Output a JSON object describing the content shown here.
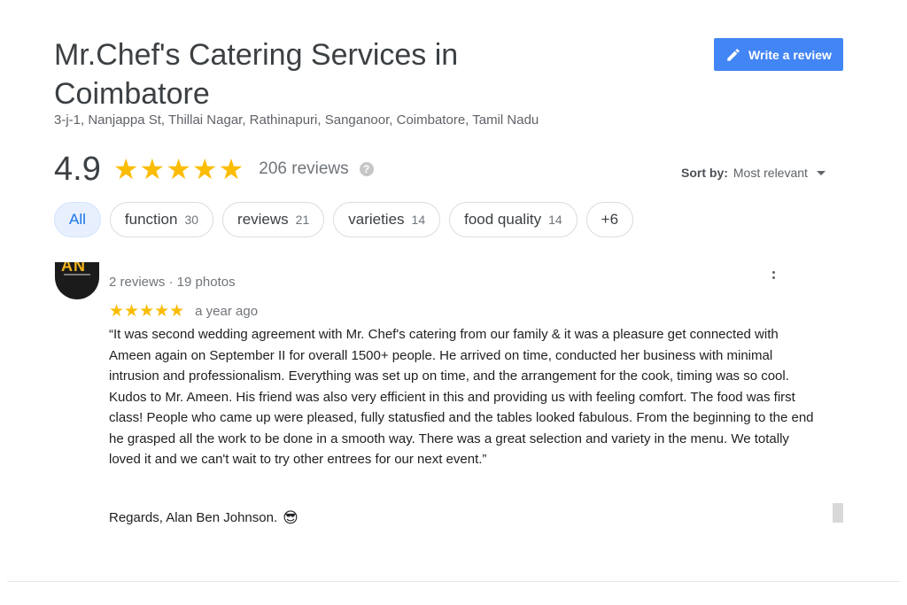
{
  "business": {
    "name": "Mr.Chef's Catering Services in Coimbatore",
    "address": "3-j-1, Nanjappa St, Thillai Nagar, Rathinapuri, Sanganoor, Coimbatore, Tamil Nadu"
  },
  "actions": {
    "write_review_label": "Write a review"
  },
  "summary": {
    "rating": "4.9",
    "stars": "★★★★★",
    "review_count": "206 reviews",
    "help_glyph": "?"
  },
  "sort": {
    "label": "Sort by:",
    "value": "Most relevant"
  },
  "filters": [
    {
      "label": "All",
      "count": ""
    },
    {
      "label": "function",
      "count": "30"
    },
    {
      "label": "reviews",
      "count": "21"
    },
    {
      "label": "varieties",
      "count": "14"
    },
    {
      "label": "food quality",
      "count": "14"
    },
    {
      "label": "+6",
      "count": ""
    }
  ],
  "review": {
    "avatar_text": "AN",
    "meta": "2 reviews · 19 photos",
    "stars": "★★★★★",
    "time": "a year ago",
    "text": "“It was second wedding agreement with Mr. Chef's catering from our family & it was a pleasure get connected with Ameen again on September II for overall 1500+ people. He arrived on time, conducted her business with minimal intrusion and professionalism. Everything was set up on time, and the arrangement for the cook, timing was so cool. Kudos to Mr. Ameen. His friend was also very efficient in this and providing us with feeling comfort. The food was first class! People who came up were pleased, fully statusfied and the tables looked fabulous. From the beginning to the end he grasped all the work to be done in a smooth way. There was a great selection and variety in the menu. We totally loved it and we can't wait to try other entrees for our next event.”",
    "signature": "Regards, Alan Ben Johnson.",
    "emoji": "😎"
  },
  "colors": {
    "accent": "#4285f4",
    "star": "#fbbc04",
    "chip_active_bg": "#e8f0fe"
  },
  "icons": {
    "write": "pencil-icon",
    "help": "help-icon",
    "more": "more-vert-icon",
    "sort": "chevron-down-icon"
  }
}
